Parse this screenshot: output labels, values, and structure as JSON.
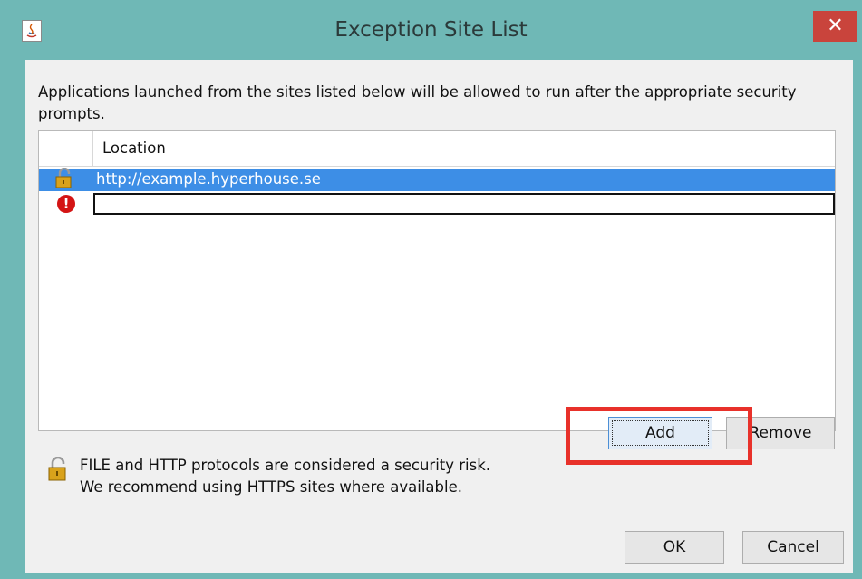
{
  "window": {
    "title": "Exception Site List",
    "close_label": "✕"
  },
  "description": "Applications launched from the sites listed below will be allowed to run after the appropriate security prompts.",
  "table": {
    "header_location": "Location",
    "rows": [
      {
        "location": "http://example.hyperhouse.se",
        "icon": "lock-warning-icon",
        "selected": true
      },
      {
        "location": "",
        "icon": "error-icon",
        "editing": true
      }
    ]
  },
  "buttons": {
    "add": "Add",
    "remove": "Remove",
    "ok": "OK",
    "cancel": "Cancel"
  },
  "warning": {
    "line1": "FILE and HTTP protocols are considered a security risk.",
    "line2": "We recommend using HTTPS sites where available."
  },
  "colors": {
    "title_bar": "#6fb8b6",
    "close_button": "#c9443c",
    "selection": "#3d8ee6",
    "annotation_box": "#e8312a"
  }
}
